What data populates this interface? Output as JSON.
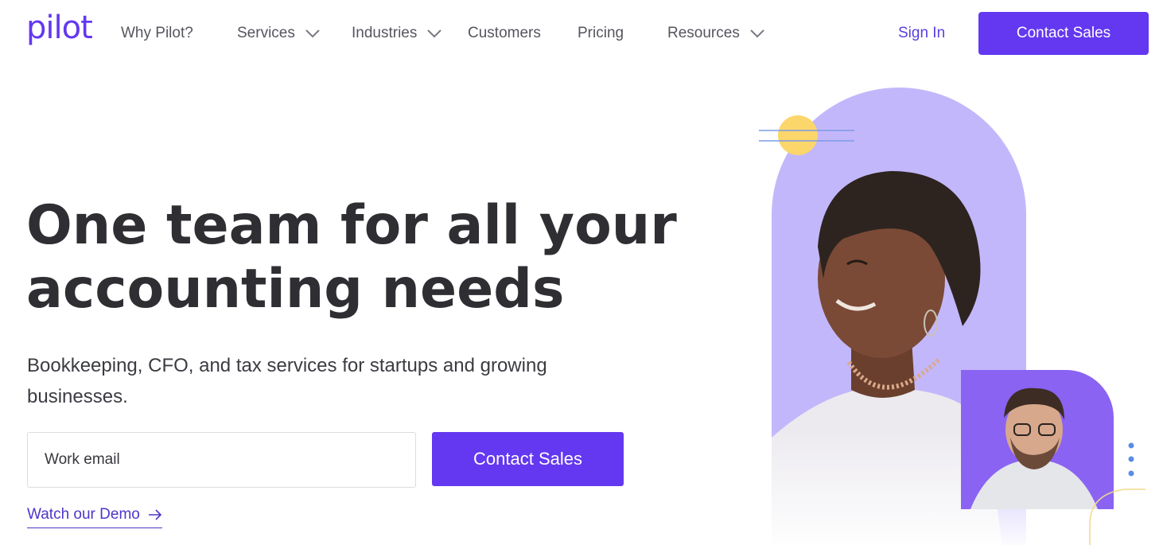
{
  "brand": {
    "logo_text": "pilot",
    "accent": "#6438f0",
    "link_color": "#4f35c9"
  },
  "nav": {
    "items": [
      {
        "label": "Why Pilot?",
        "has_dropdown": false
      },
      {
        "label": "Services",
        "has_dropdown": true
      },
      {
        "label": "Industries",
        "has_dropdown": true
      },
      {
        "label": "Customers",
        "has_dropdown": false
      },
      {
        "label": "Pricing",
        "has_dropdown": false
      },
      {
        "label": "Resources",
        "has_dropdown": true
      }
    ],
    "sign_in": "Sign In",
    "cta": "Contact Sales"
  },
  "hero": {
    "headline_line1": "One team for all your",
    "headline_line2": "accounting needs",
    "subheadline": "Bookkeeping, CFO, and tax services for startups and growing businesses.",
    "email_placeholder": "Work email",
    "cta": "Contact Sales",
    "demo_link": "Watch our Demo"
  },
  "illustration": {
    "icons": [
      "sun-decoration",
      "arch-shape",
      "woman-photo",
      "man-photo",
      "dots-decoration"
    ],
    "colors": {
      "arch": "#c3b7fb",
      "small_arch": "#8a63f2",
      "sun": "#fbd66a",
      "lines": "#7c9be6"
    }
  }
}
